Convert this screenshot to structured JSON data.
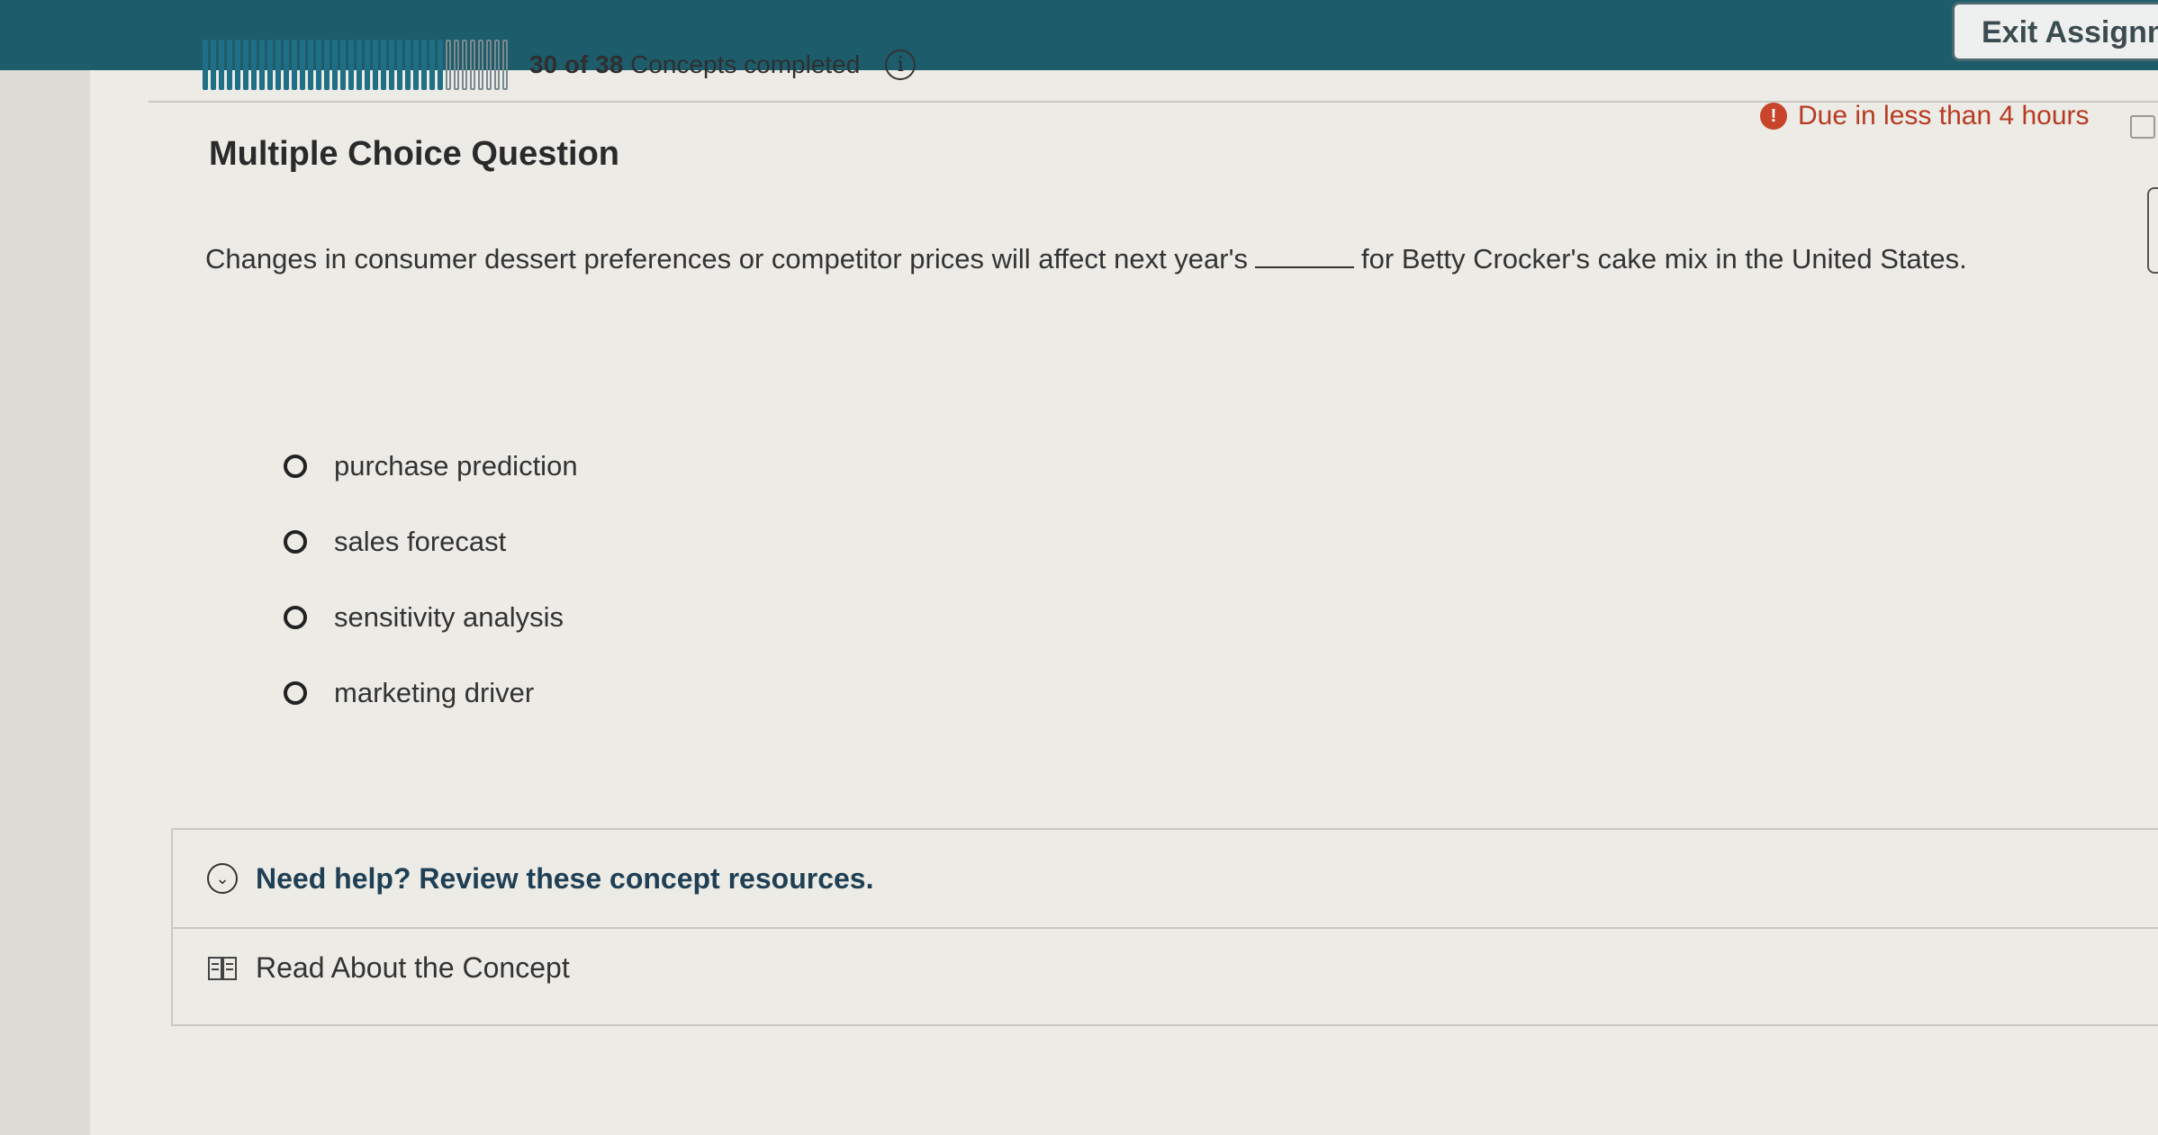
{
  "header": {
    "exit_label": "Exit Assignme",
    "progress": {
      "completed": 30,
      "total": 38,
      "count_text": "30 of 38",
      "suffix": "Concepts completed"
    },
    "due_text": "Due in less than 4 hours"
  },
  "question": {
    "type_label": "Multiple Choice Question",
    "stem_before": "Changes in consumer dessert preferences or competitor prices will affect next year's",
    "stem_after": "for Betty Crocker's cake mix in the United States.",
    "options": [
      {
        "label": "purchase prediction"
      },
      {
        "label": "sales forecast"
      },
      {
        "label": "sensitivity analysis"
      },
      {
        "label": "marketing driver"
      }
    ]
  },
  "help": {
    "title": "Need help? Review these concept resources.",
    "read_label": "Read About the Concept"
  },
  "colors": {
    "topbar": "#1d5c6b",
    "progress_fill": "#1f6f86",
    "due": "#b73b22",
    "help_title": "#1f3f54"
  },
  "icons": [
    "info-icon",
    "alert-icon",
    "calendar-icon",
    "chevron-down-icon",
    "book-icon"
  ]
}
